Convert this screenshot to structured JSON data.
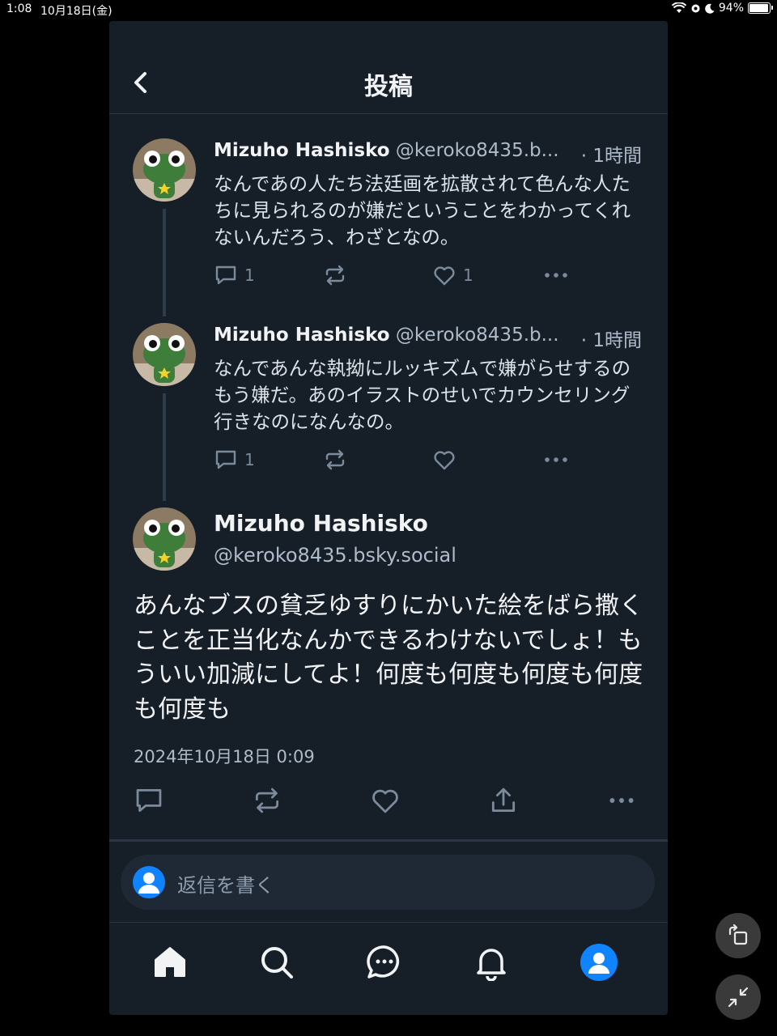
{
  "status_bar": {
    "time": "1:08",
    "date": "10月18日(金)",
    "battery": "94%"
  },
  "header": {
    "title": "投稿"
  },
  "replies": [
    {
      "name": "Mizuho Hashisko",
      "handle": "@keroko8435.b...",
      "time": "· 1時間",
      "text": "なんであの人たち法廷画を拡散されて色んな人たちに見られるのが嫌だということをわかってくれないんだろう、わざとなの。",
      "reply_count": "1",
      "repost_count": "",
      "like_count": "1"
    },
    {
      "name": "Mizuho Hashisko",
      "handle": "@keroko8435.b...",
      "time": "· 1時間",
      "text": "なんであんな執拗にルッキズムで嫌がらせするのもう嫌だ。あのイラストのせいでカウンセリング行きなのになんなの。",
      "reply_count": "1",
      "repost_count": "",
      "like_count": ""
    }
  ],
  "main_post": {
    "name": "Mizuho Hashisko",
    "handle": "@keroko8435.bsky.social",
    "text": "あんなブスの貧乏ゆすりにかいた絵をばら撒くことを正当化なんかできるわけないでしょ！もういい加減にしてよ！何度も何度も何度も何度も何度も",
    "date": "2024年10月18日 0:09"
  },
  "composer": {
    "placeholder": "返信を書く"
  },
  "tabbar": [
    "home-icon",
    "search-icon",
    "chat-icon",
    "bell-icon",
    "profile-icon"
  ],
  "colors": {
    "background": "#161e27",
    "accent": "#1083fe",
    "muted": "#aebbc9",
    "icon": "#7b8b9c"
  }
}
